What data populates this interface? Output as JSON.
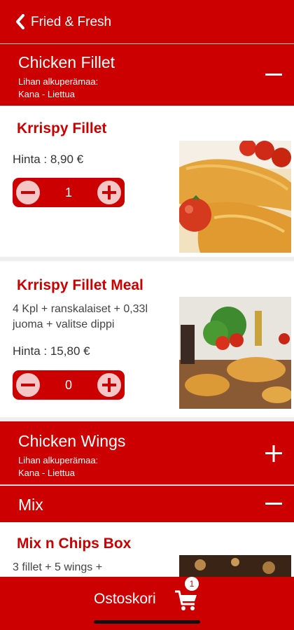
{
  "header": {
    "title": "Fried & Fresh"
  },
  "categories": [
    {
      "title": "Chicken Fillet",
      "origin_label": "Lihan alkuperämaa:",
      "origin_value": "Kana - Liettua",
      "toggle": "minus-icon"
    },
    {
      "title": "Chicken Wings",
      "origin_label": "Lihan alkuperämaa:",
      "origin_value": "Kana - Liettua",
      "toggle": "plus-icon"
    },
    {
      "title": "Mix",
      "toggle": "minus-icon"
    }
  ],
  "products": [
    {
      "name": "Krrispy Fillet",
      "price": "Hinta : 8,90 €",
      "quantity": "1"
    },
    {
      "name": "Krrispy Fillet Meal",
      "description": "4 Kpl + ranskalaiset + 0,33l juoma + valitse dippi",
      "price": "Hinta : 15,80 €",
      "quantity": "0"
    },
    {
      "name": "Mix n Chips Box",
      "description": "3 fillet + 5 wings +"
    }
  ],
  "cart": {
    "label": "Ostoskori",
    "count": "1"
  },
  "colors": {
    "accent": "#cc0000",
    "stepper_button": "#f4c6c6"
  }
}
